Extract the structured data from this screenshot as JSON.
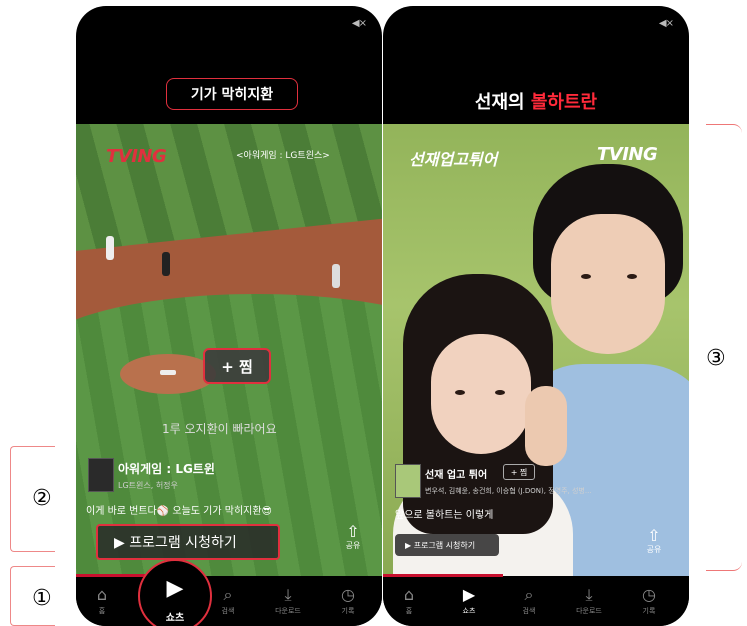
{
  "left": {
    "title": "기가 막히지환",
    "video_brand": "TVING",
    "video_caption": "<아워게임 : LG트윈스>",
    "subtitle": "1루 오지환이 빠라어요",
    "program_name": "아워게임 : LG트윈",
    "program_sub": "LG트윈스, 허정우",
    "zzim_label": "+ 찜",
    "description": "이게 바로 번트다⚾ 오늘도 기가 막히지환😎",
    "watch_label": "▶  프로그램 시청하기",
    "share_label": "공유"
  },
  "right": {
    "title_prefix": "선재의 ",
    "title_highlight": "볼하트란",
    "video_brand": "TVING",
    "video_title": "선재업고튀어",
    "program_name": "선재 업고 튀어",
    "zzim_label": "+ 찜",
    "program_sub": "변우석, 김혜윤, 송건희, 이승협 (J.DON), 정영주, 성병...",
    "description": "앞으로 볼하트는 이렇게",
    "watch_label": "▶  프로그램 시청하기",
    "share_label": "공유"
  },
  "tabs": [
    {
      "icon": "⌂",
      "label": "홈"
    },
    {
      "icon": "▶",
      "label": "쇼츠"
    },
    {
      "icon": "⌕",
      "label": "검색"
    },
    {
      "icon": "⤓",
      "label": "다운로드"
    },
    {
      "icon": "◷",
      "label": "기록"
    }
  ],
  "annotations": {
    "one": "①",
    "two": "②",
    "three": "③"
  },
  "colors": {
    "accent": "#e0303e",
    "brand_red": "#c8102e"
  }
}
